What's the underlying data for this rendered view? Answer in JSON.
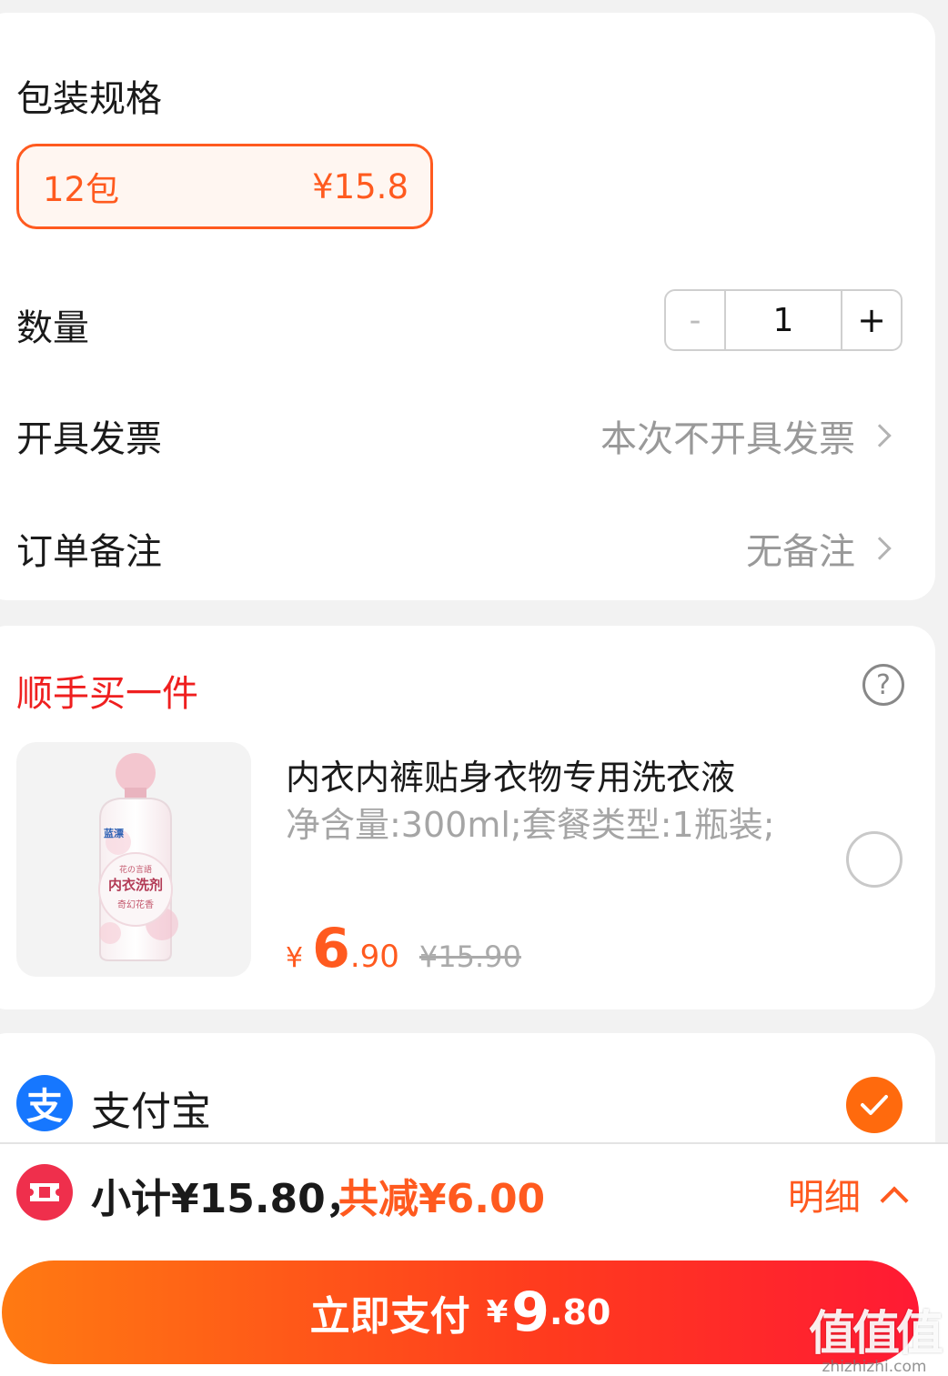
{
  "spec": {
    "label": "包装规格",
    "option_name": "12包",
    "option_price": "¥15.8"
  },
  "quantity": {
    "label": "数量",
    "minus": "-",
    "value": "1",
    "plus": "+"
  },
  "invoice": {
    "label": "开具发票",
    "value": "本次不开具发票"
  },
  "remark": {
    "label": "订单备注",
    "value": "无备注"
  },
  "addon": {
    "title": "顺手买一件",
    "help": "?",
    "product_name": "内衣内裤贴身衣物专用洗衣液",
    "product_spec": "净含量:300ml;套餐类型:1瓶装;",
    "price_currency": "¥",
    "price_int": "6",
    "price_dec": ".90",
    "original_price": "¥15.90",
    "image_brand": "蓝漂",
    "image_title_small": "花の言語",
    "image_title": "内衣洗剂",
    "image_sub": "奇幻花香"
  },
  "payment": {
    "method": "支付宝",
    "icon_glyph": "支",
    "selected": true
  },
  "summary": {
    "subtotal": "小计¥15.80，",
    "discount": "共减¥6.00",
    "detail": "明细"
  },
  "pay_button": {
    "label": "立即支付",
    "currency": "¥",
    "amount_int": "9",
    "amount_dec": ".80"
  },
  "watermark": {
    "big": "值值值",
    "small": "zhizhizhi.com"
  },
  "colors": {
    "accent": "#ff5a1f",
    "red_title": "#ef1f1f",
    "alipay_blue": "#1677ff"
  }
}
